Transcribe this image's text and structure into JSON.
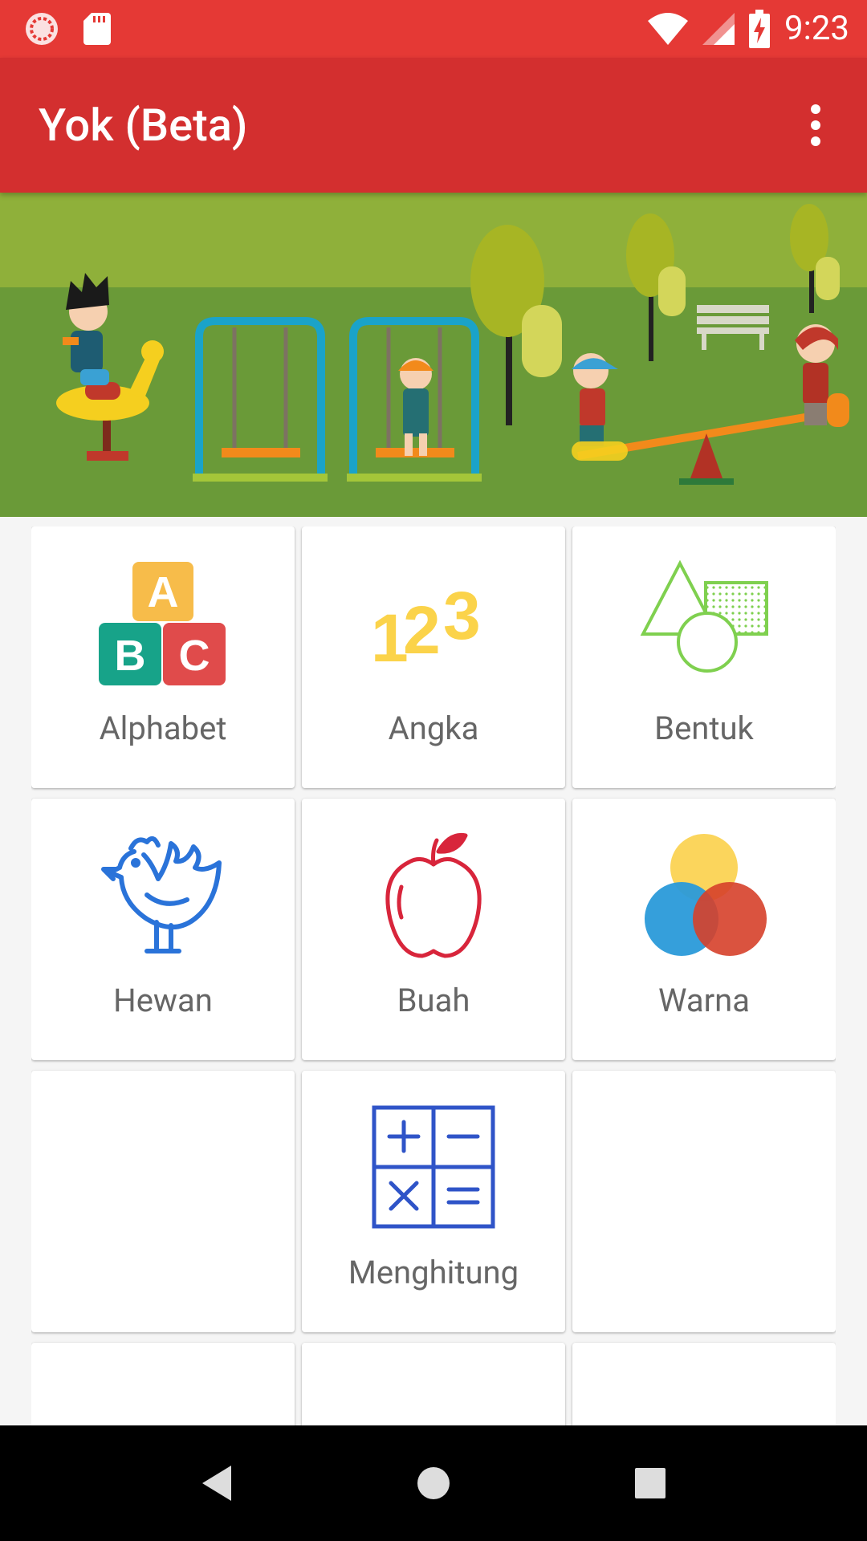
{
  "status_bar": {
    "time": "9:23",
    "icons": [
      "loading-indicator-icon",
      "sd-card-icon",
      "wifi-icon",
      "signal-icon",
      "battery-charging-icon"
    ]
  },
  "app_bar": {
    "title": "Yok (Beta)",
    "overflow_icon": "more-vert-icon"
  },
  "banner": {
    "image": "playground-illustration"
  },
  "menu": {
    "items": [
      {
        "label": "Alphabet",
        "icon": "abc-blocks-icon"
      },
      {
        "label": "Angka",
        "icon": "numbers-123-icon"
      },
      {
        "label": "Bentuk",
        "icon": "shapes-icon"
      },
      {
        "label": "Hewan",
        "icon": "rooster-icon"
      },
      {
        "label": "Buah",
        "icon": "apple-icon"
      },
      {
        "label": "Warna",
        "icon": "color-circles-icon"
      },
      {
        "label": "",
        "icon": ""
      },
      {
        "label": "Menghitung",
        "icon": "math-operators-icon"
      },
      {
        "label": "",
        "icon": ""
      }
    ]
  },
  "nav_bar": {
    "icons": [
      "back-icon",
      "home-icon",
      "recents-icon"
    ]
  },
  "colors": {
    "status_bar": "#e53935",
    "app_bar": "#d32f2f",
    "label_text": "#666666"
  }
}
